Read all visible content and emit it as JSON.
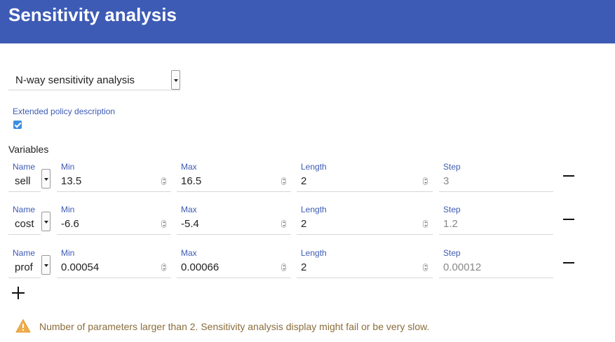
{
  "header": {
    "title": "Sensitivity analysis"
  },
  "mode_select": {
    "value": "N-way sensitivity analysis"
  },
  "extended_policy": {
    "label": "Extended policy description",
    "checked": true
  },
  "variables": {
    "title": "Variables",
    "labels": {
      "name": "Name",
      "min": "Min",
      "max": "Max",
      "length": "Length",
      "step": "Step"
    },
    "rows": [
      {
        "name": "sell",
        "min": "13.5",
        "max": "16.5",
        "length": "2",
        "step": "3"
      },
      {
        "name": "cost",
        "min": "-6.6",
        "max": "-5.4",
        "length": "2",
        "step": "1.2"
      },
      {
        "name": "prof",
        "min": "0.00054",
        "max": "0.00066",
        "length": "2",
        "step": "0.00012"
      }
    ]
  },
  "warning": {
    "text": "Number of parameters larger than 2. Sensitivity analysis display might fail or be very slow.",
    "color": "#8a6d3b",
    "icon": "warning-triangle-icon"
  },
  "colors": {
    "header": "#3d5bb5",
    "label": "#3d5bb5",
    "checkbox": "#3b8ee0"
  }
}
